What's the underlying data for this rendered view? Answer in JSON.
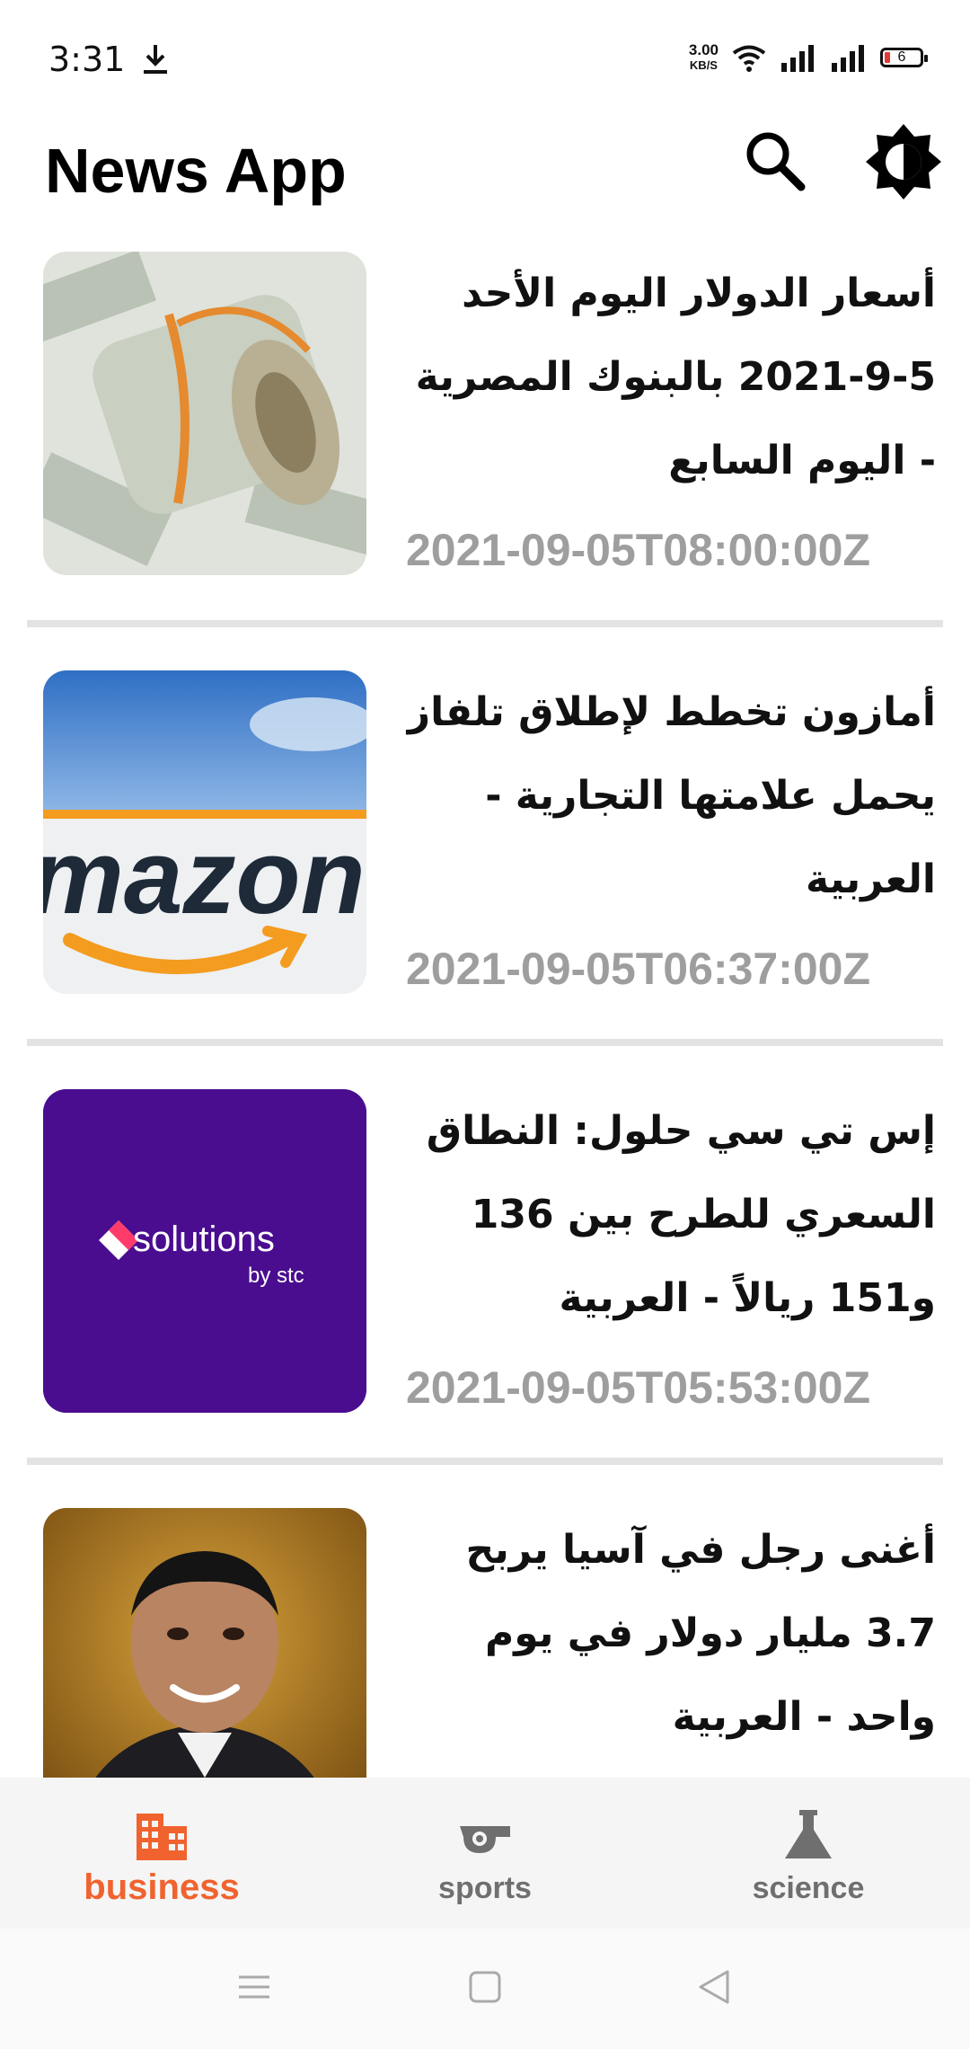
{
  "status_bar": {
    "time": "3:31",
    "net_speed_value": "3.00",
    "net_speed_unit": "KB/S",
    "battery_level": "6",
    "icons": [
      "download-icon",
      "wifi-icon",
      "signal-icon",
      "signal-icon",
      "battery-icon"
    ]
  },
  "app_bar": {
    "title": "News App",
    "search_icon": "search-icon",
    "theme_icon": "theme-toggle-icon"
  },
  "articles": [
    {
      "title": "أسعار الدولار اليوم الأحد 5-9-2021 بالبنوك المصرية - اليوم السابع",
      "date": "2021-09-05T08:00:00Z",
      "image": "dollar-bills-photo"
    },
    {
      "title": "أمازون تخطط لإطلاق تلفاز يحمل علامتها التجارية - العربية",
      "date": "2021-09-05T06:37:00Z",
      "image": "amazon-logo-photo"
    },
    {
      "title": "إس تي سي حلول: النطاق السعري للطرح بين 136 و151 ريالاً - العربية",
      "date": "2021-09-05T05:53:00Z",
      "image": "solutions-by-stc-logo",
      "image_text": {
        "brand": "solutions",
        "by": "by stc"
      }
    },
    {
      "title": "أغنى رجل في آسيا يربح 3.7 مليار دولار في يوم واحد - العربية",
      "date": "",
      "image": "portrait-photo"
    }
  ],
  "bottom_nav": [
    {
      "label": "business",
      "icon": "business-building-icon",
      "active": true
    },
    {
      "label": "sports",
      "icon": "whistle-icon",
      "active": false
    },
    {
      "label": "science",
      "icon": "flask-icon",
      "active": false
    }
  ],
  "colors": {
    "accent": "#f0632e",
    "inactive": "#6f6f6f",
    "date": "#9e9e9e",
    "stc_purple": "#4a0d8f"
  }
}
